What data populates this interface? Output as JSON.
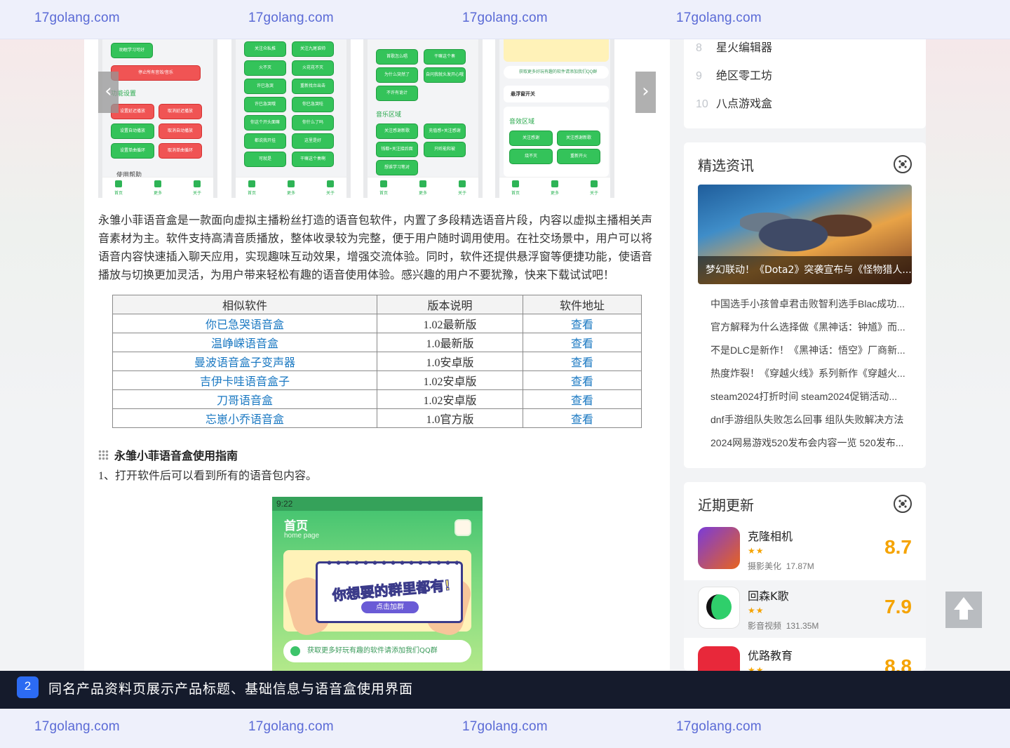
{
  "watermark": {
    "text": "17golang.com"
  },
  "gallery": {
    "screens": [
      {
        "buttons": [
          "助眠学习可好",
          "停止所有音效/音乐",
          "设置延迟播放",
          "取消延迟播放",
          "设置自动播放",
          "取消自动播放",
          "设置单曲循环",
          "取消单曲循环"
        ],
        "section": "功能设置",
        "footer_section": "使用帮助"
      },
      {
        "buttons": [
          "关注众私推",
          "关注九尾谁帅",
          "火不灭",
          "火花花不灭",
          "许巳急哭",
          "重新找台出击",
          "许巳急哭哦",
          "你巳急哭哇",
          "你这个开头面嘛",
          "你什么了吗",
          "都说我开挂",
          "这里是好",
          "可就是",
          "干嘛这个奏啊"
        ]
      },
      {
        "buttons": [
          "首歌怎么唱",
          "干嘛这个奏",
          "为什么突然了",
          "自问我就头发开心哦",
          "不许有诡计"
        ],
        "section": "音乐区域",
        "buttons2": [
          "关注感谢新歌",
          "充值感+关注感谢",
          "钱都+关注接后面",
          "只听能和被",
          "想谁学习笔对"
        ]
      },
      {
        "section": "音效区域",
        "toggle": "悬浮窗开关",
        "notice": "获取更多好玩有趣的软件请添加我们QQ群",
        "buttons": [
          "关注感谢",
          "关注感谢新歌",
          "烧不灭",
          "重新开火"
        ]
      }
    ],
    "nav_labels": [
      "首页",
      "更多",
      "关于"
    ],
    "prev_icon": "chevron-left-icon",
    "next_icon": "chevron-right-icon",
    "prev_glyph": "‹",
    "next_glyph": "›"
  },
  "description": "永雏小菲语音盒是一款面向虚拟主播粉丝打造的语音包软件，内置了多段精选语音片段，内容以虚拟主播相关声音素材为主。软件支持高清音质播放，整体收录较为完整，便于用户随时调用使用。在社交场景中，用户可以将语音内容快速插入聊天应用，实现趣味互动效果，增强交流体验。同时，软件还提供悬浮窗等便捷功能，使语音播放与切换更加灵活，为用户带来轻松有趣的语音使用体验。感兴趣的用户不要犹豫，快来下载试试吧！",
  "similar_table": {
    "headers": [
      "相似软件",
      "版本说明",
      "软件地址"
    ],
    "rows": [
      {
        "name": "你已急哭语音盒",
        "version": "1.02最新版",
        "link": "查看"
      },
      {
        "name": "温峥嵘语音盒",
        "version": "1.0最新版",
        "link": "查看"
      },
      {
        "name": "曼波语音盒子变声器",
        "version": "1.0安卓版",
        "link": "查看"
      },
      {
        "name": "吉伊卡哇语音盒子",
        "version": "1.02安卓版",
        "link": "查看"
      },
      {
        "name": "刀哥语音盒",
        "version": "1.02安卓版",
        "link": "查看"
      },
      {
        "name": "忘崽小乔语音盒",
        "version": "1.0官方版",
        "link": "查看"
      }
    ]
  },
  "guide": {
    "title": "永雏小菲语音盒使用指南",
    "step1": "1、打开软件后可以看到所有的语音包内容。"
  },
  "phone": {
    "time": "9:22",
    "title": "首页",
    "subtitle": "home page",
    "slogan": "你想要的群里都有!",
    "join_btn": "点击加群",
    "notice": "获取更多好玩有趣的软件请添加我们QQ群"
  },
  "sidebar": {
    "ranking": [
      {
        "num": "8",
        "title": "星火编辑器"
      },
      {
        "num": "9",
        "title": "绝区零工坊"
      },
      {
        "num": "10",
        "title": "八点游戏盒"
      }
    ],
    "news": {
      "title": "精选资讯",
      "hero_caption": "梦幻联动！《Dota2》突袭宣布与《怪物猎人...",
      "items": [
        "中国选手小孩曾卓君击败智利选手Blac成功...",
        "官方解释为什么选择做《黑神话：钟馗》而...",
        "不是DLC是新作！《黑神话：悟空》厂商新...",
        "热度炸裂！《穿越火线》系列新作《穿越火...",
        "steam2024打折时间 steam2024促销活动...",
        "dnf手游组队失败怎么回事 组队失败解决方法",
        "2024网易游戏520发布会内容一览 520发布..."
      ]
    },
    "recent": {
      "title": "近期更新",
      "apps": [
        {
          "name": "克隆相机",
          "stars": "★★",
          "category": "摄影美化",
          "size": "17.87M",
          "score": "8.7",
          "icon_color": "#e8641e"
        },
        {
          "name": "回森K歌",
          "stars": "★★",
          "category": "影音视频",
          "size": "131.35M",
          "score": "7.9",
          "icon_color": "#2fcf6b"
        },
        {
          "name": "优路教育",
          "stars": "★★",
          "category": "",
          "size": "",
          "score": "8.8",
          "icon_color": "#e8283a"
        }
      ]
    }
  },
  "back_to_top_icon": "arrow-up-icon",
  "caption": {
    "number": "2",
    "text": "同名产品资料页展示产品标题、基础信息与语音盒使用界面"
  }
}
